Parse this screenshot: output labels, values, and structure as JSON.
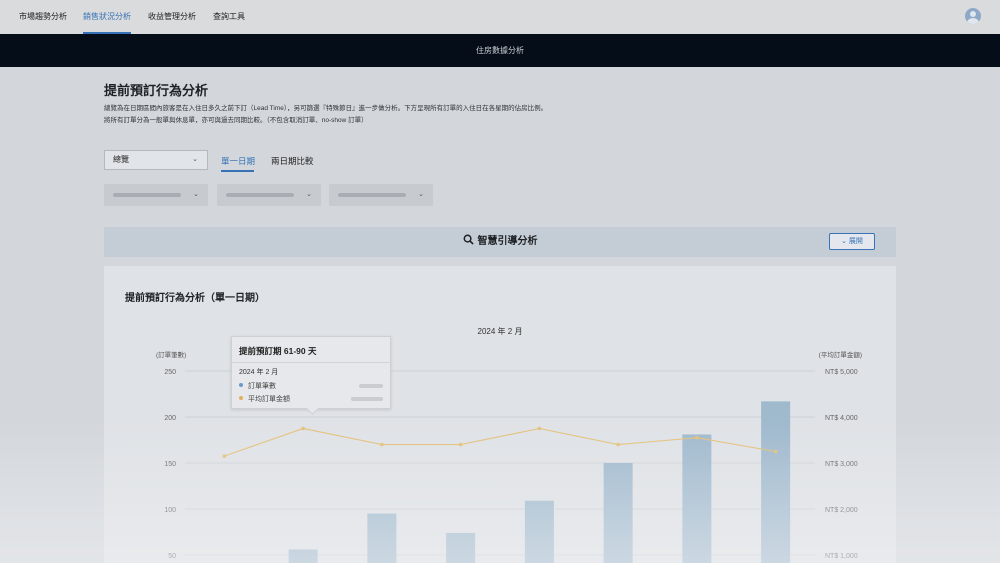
{
  "nav": {
    "tabs": [
      "市場趨勢分析",
      "銷售狀況分析",
      "收益管理分析",
      "查詢工具"
    ],
    "active_index": 1
  },
  "banner": {
    "title": "住房數據分析"
  },
  "page": {
    "title": "提前預訂行為分析",
    "description_line1": "總覽為在日期區間內旅客是在入住日多久之前下訂（Lead Time），另可篩選『特殊節日』進一步做分析。下方呈現所有訂單的入住日在各星期的佔房比例。",
    "description_line2": "將所有訂單分為一般單與休息單，亦可與過去同期比較。（不包含取消訂單、no-show 訂單）"
  },
  "controls": {
    "view_select": "總覽",
    "mode_tabs": [
      "單一日期",
      "兩日期比較"
    ],
    "active_mode": 0
  },
  "guide": {
    "title": "智慧引導分析",
    "expand_label": "展開"
  },
  "chart_card": {
    "title": "提前預訂行為分析（單一日期）"
  },
  "chart_data": {
    "type": "bar",
    "title": "2024 年 2 月",
    "ylabel_left": "(訂單筆數)",
    "ylabel_right": "(平均訂單金額)",
    "left_ticks": [
      "250",
      "200",
      "150",
      "100",
      "50"
    ],
    "right_ticks": [
      "NT$ 5,000",
      "NT$ 4,000",
      "NT$ 3,000",
      "NT$ 2,000",
      "NT$ 1,000"
    ],
    "ylim_left": [
      0,
      250
    ],
    "ylim_right": [
      0,
      5000
    ],
    "grid": true,
    "series": [
      {
        "name": "訂單筆數",
        "type": "bar",
        "color": "#9fb9cd",
        "values": [
          0,
          56,
          95,
          74,
          109,
          150,
          181,
          217
        ]
      },
      {
        "name": "平均訂單金額",
        "type": "line",
        "color": "#e3c078",
        "values": [
          3150,
          3750,
          3400,
          3400,
          3750,
          3400,
          3550,
          3250
        ]
      }
    ]
  },
  "tooltip": {
    "title": "提前預訂期 61-90 天",
    "period": "2024 年 2 月",
    "series": [
      {
        "name": "訂單筆數",
        "color": "#6e9bc9"
      },
      {
        "name": "平均訂單金額",
        "color": "#e0b25e"
      }
    ]
  }
}
